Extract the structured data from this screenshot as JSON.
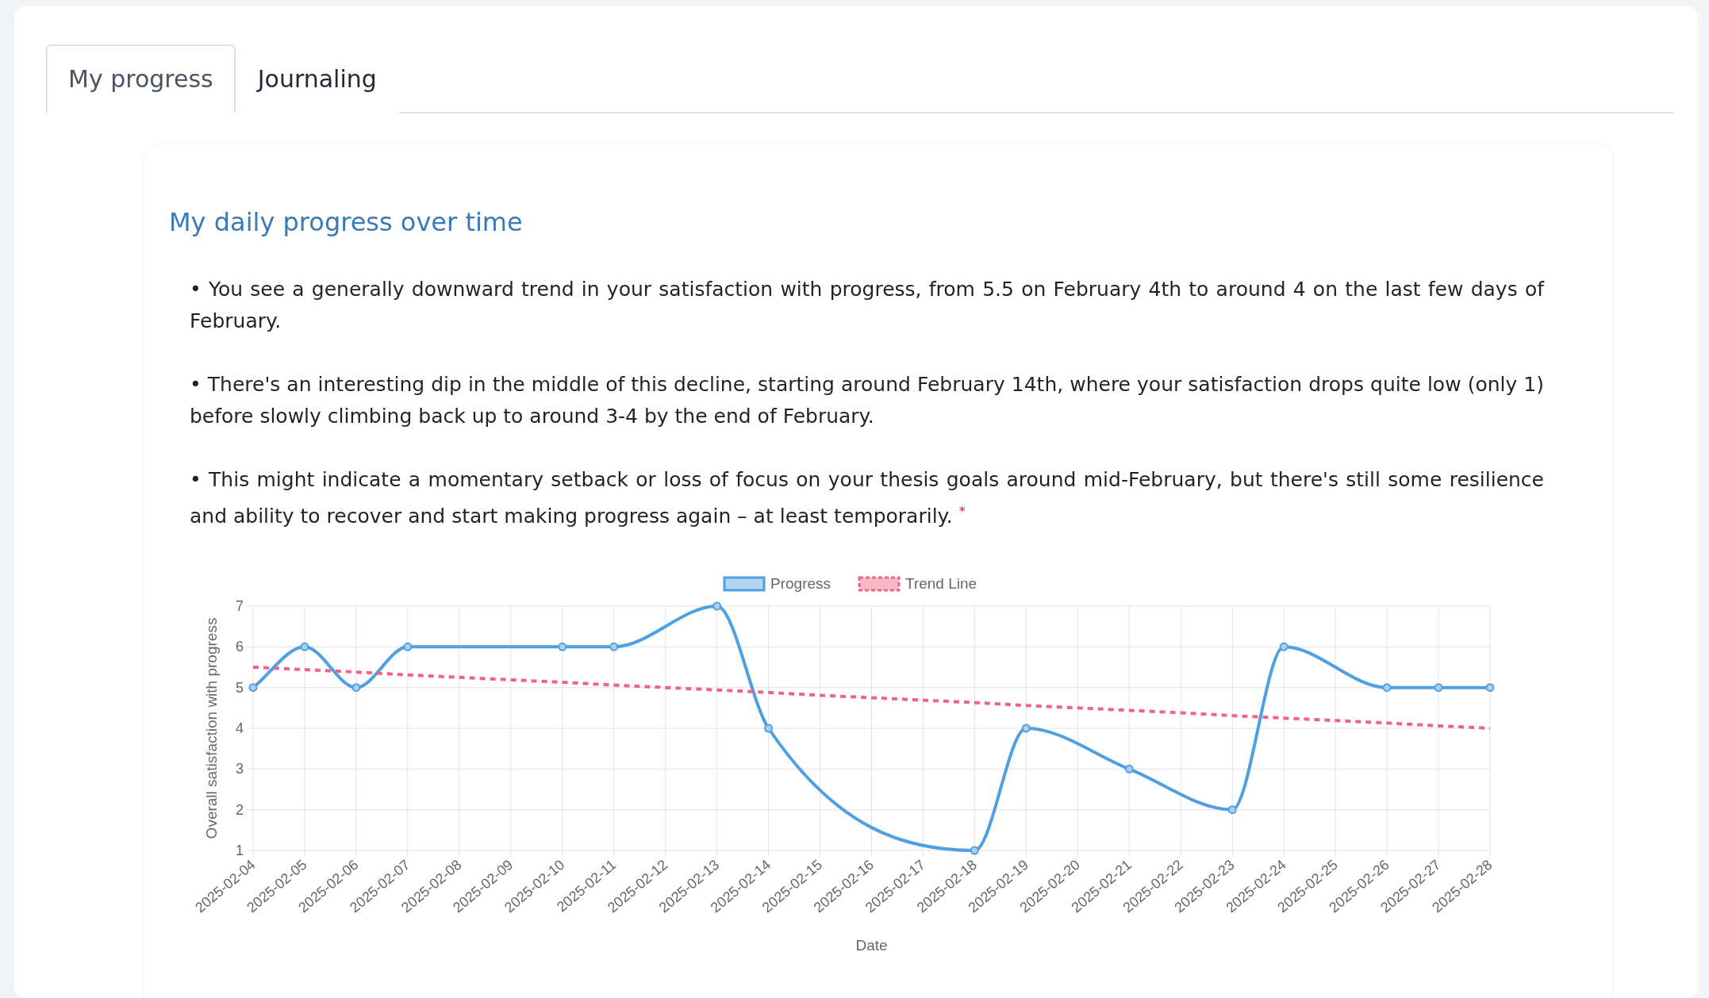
{
  "tabs": [
    {
      "label": "My progress",
      "selected": true
    },
    {
      "label": "Journaling",
      "selected": false
    }
  ],
  "panel": {
    "title": "My daily progress over time",
    "paragraphs": [
      "• You see a generally downward trend in your satisfaction with progress, from 5.5 on February 4th to around 4 on the last few days of February.",
      "• There's an interesting dip in the middle of this decline, starting around February 14th, where your satisfaction drops quite low (only 1) before slowly climbing back up to around 3-4 by the end of February.",
      "• This might indicate a momentary setback or loss of focus on your thesis goals around mid-February, but there's still some resilience and ability to recover and start making progress again – at least temporarily. $^{*}$"
    ],
    "chart_data": {
      "type": "line",
      "xlabel": "Date",
      "ylabel": "Overall satisfaction with progress",
      "grid": true,
      "legend": true,
      "categories": [
        "2025-02-04",
        "2025-02-05",
        "2025-02-06",
        "2025-02-07",
        "2025-02-08",
        "2025-02-09",
        "2025-02-10",
        "2025-02-11",
        "2025-02-12",
        "2025-02-13",
        "2025-02-14",
        "2025-02-15",
        "2025-02-16",
        "2025-02-17",
        "2025-02-18",
        "2025-02-19",
        "2025-02-20",
        "2025-02-21",
        "2025-02-22",
        "2025-02-23",
        "2025-02-24",
        "2025-02-25",
        "2025-02-26",
        "2025-02-27",
        "2025-02-28"
      ],
      "series": [
        {
          "name": "Progress",
          "color": "#4f9fe3",
          "line_style": "solid",
          "marker": "circle",
          "values": [
            5,
            6,
            5,
            6,
            null,
            null,
            6,
            6,
            null,
            7,
            4,
            null,
            null,
            null,
            1,
            4,
            null,
            3,
            null,
            2,
            6,
            null,
            5,
            5,
            5
          ]
        },
        {
          "name": "Trend Line",
          "color": "#f06483",
          "line_style": "dashed",
          "values": [
            5.5,
            5.44,
            5.38,
            5.31,
            5.25,
            5.19,
            5.13,
            5.06,
            5,
            4.94,
            4.88,
            4.81,
            4.75,
            4.69,
            4.63,
            4.56,
            4.5,
            4.44,
            4.38,
            4.31,
            4.25,
            4.19,
            4.13,
            4.06,
            4
          ]
        }
      ],
      "ylim": [
        1,
        7
      ],
      "yticks": [
        1,
        2,
        3,
        4,
        5,
        6,
        7
      ]
    }
  }
}
